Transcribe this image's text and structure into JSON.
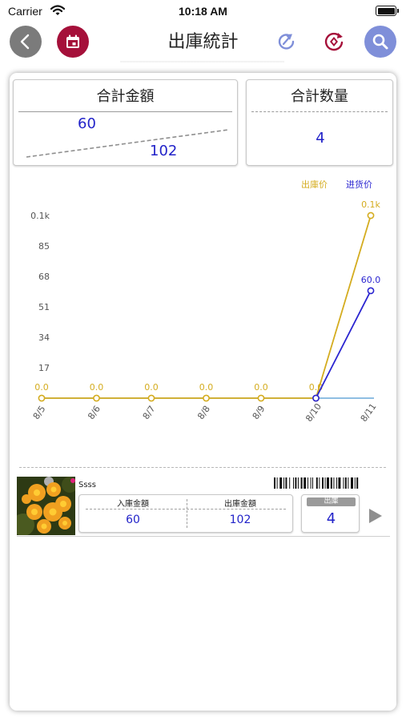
{
  "status_bar": {
    "carrier": "Carrier",
    "time": "10:18 AM"
  },
  "nav": {
    "title": "出庫統計",
    "icons": [
      "back-icon",
      "calendar-icon",
      "share-icon",
      "convert-icon",
      "search-icon"
    ]
  },
  "colors": {
    "gold": "#d4ac1f",
    "blue": "#2a24d0",
    "base_line": "#6aa8d8",
    "value_blue": "#2223c9",
    "calendar_red": "#a5103a",
    "search_blue": "#7f8fd9"
  },
  "summary": {
    "amount_title": "合計金額",
    "amount_in": "60",
    "amount_out": "102",
    "qty_title": "合計数量",
    "qty_value": "4"
  },
  "chart_data": {
    "type": "line",
    "legend": [
      "出庫价",
      "进货价"
    ],
    "legend_placement": "top-right",
    "categories": [
      "8/5",
      "8/6",
      "8/7",
      "8/8",
      "8/9",
      "8/10",
      "8/11"
    ],
    "ylim": [
      0,
      102
    ],
    "yticks": [
      "0.1k",
      "85",
      "68",
      "51",
      "34",
      "17"
    ],
    "grid": false,
    "series": [
      {
        "name": "出庫价",
        "color": "#d4ac1f",
        "values": [
          0,
          0,
          0,
          0,
          0,
          0,
          102
        ],
        "labels": [
          "0.0",
          "0.0",
          "0.0",
          "0.0",
          "0.0",
          "0.0",
          "0.1k"
        ]
      },
      {
        "name": "进货价",
        "color": "#2a24d0",
        "values": [
          null,
          null,
          null,
          null,
          null,
          0,
          60
        ],
        "labels": [
          "",
          "",
          "",
          "",
          "",
          "",
          "60.0"
        ]
      }
    ]
  },
  "product": {
    "name": "Ssss",
    "in_label": "入庫金額",
    "in_value": "60",
    "out_label": "出庫金額",
    "out_value": "102",
    "badge": "出庫",
    "count": "4"
  }
}
